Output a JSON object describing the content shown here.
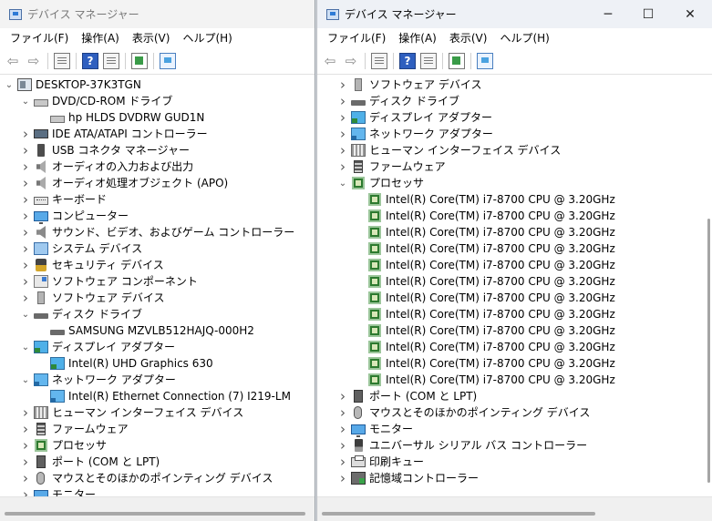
{
  "title": "デバイス マネージャー",
  "menu": [
    "ファイル(F)",
    "操作(A)",
    "表示(V)",
    "ヘルプ(H)"
  ],
  "window_controls": {
    "minimize": "─",
    "maximize": "☐",
    "close": "✕"
  },
  "toolbar": {
    "back": "⇦",
    "forward": "⇨",
    "help": "?"
  },
  "left_tree": [
    {
      "indent": 0,
      "toggle": "v",
      "icon": "computer-icon",
      "label": "DESKTOP-37K3TGN"
    },
    {
      "indent": 1,
      "toggle": "v",
      "icon": "dvd-drive-icon",
      "label": "DVD/CD-ROM ドライブ"
    },
    {
      "indent": 2,
      "toggle": "",
      "icon": "dvd-drive-icon",
      "label": "hp HLDS DVDRW  GUD1N"
    },
    {
      "indent": 1,
      "toggle": ">",
      "icon": "ide-controller-icon",
      "label": "IDE ATA/ATAPI コントローラー"
    },
    {
      "indent": 1,
      "toggle": ">",
      "icon": "usb-connector-icon",
      "label": "USB コネクタ マネージャー"
    },
    {
      "indent": 1,
      "toggle": ">",
      "icon": "audio-io-icon",
      "label": "オーディオの入力および出力"
    },
    {
      "indent": 1,
      "toggle": ">",
      "icon": "audio-apo-icon",
      "label": "オーディオ処理オブジェクト (APO)"
    },
    {
      "indent": 1,
      "toggle": ">",
      "icon": "keyboard-icon",
      "label": "キーボード"
    },
    {
      "indent": 1,
      "toggle": ">",
      "icon": "monitor-icon",
      "label": "コンピューター"
    },
    {
      "indent": 1,
      "toggle": ">",
      "icon": "sound-icon",
      "label": "サウンド、ビデオ、およびゲーム コントローラー"
    },
    {
      "indent": 1,
      "toggle": ">",
      "icon": "system-device-icon",
      "label": "システム デバイス"
    },
    {
      "indent": 1,
      "toggle": ">",
      "icon": "security-device-icon",
      "label": "セキュリティ デバイス"
    },
    {
      "indent": 1,
      "toggle": ">",
      "icon": "software-component-icon",
      "label": "ソフトウェア コンポーネント"
    },
    {
      "indent": 1,
      "toggle": ">",
      "icon": "software-device-icon",
      "label": "ソフトウェア デバイス"
    },
    {
      "indent": 1,
      "toggle": "v",
      "icon": "disk-drive-icon",
      "label": "ディスク ドライブ"
    },
    {
      "indent": 2,
      "toggle": "",
      "icon": "disk-drive-icon",
      "label": "SAMSUNG MZVLB512HAJQ-000H2"
    },
    {
      "indent": 1,
      "toggle": "v",
      "icon": "display-adapter-icon",
      "label": "ディスプレイ アダプター"
    },
    {
      "indent": 2,
      "toggle": "",
      "icon": "display-adapter-icon",
      "label": "Intel(R) UHD Graphics 630"
    },
    {
      "indent": 1,
      "toggle": "v",
      "icon": "network-adapter-icon",
      "label": "ネットワーク アダプター"
    },
    {
      "indent": 2,
      "toggle": "",
      "icon": "network-adapter-icon",
      "label": "Intel(R) Ethernet Connection (7) I219-LM"
    },
    {
      "indent": 1,
      "toggle": ">",
      "icon": "hid-icon",
      "label": "ヒューマン インターフェイス デバイス"
    },
    {
      "indent": 1,
      "toggle": ">",
      "icon": "firmware-icon",
      "label": "ファームウェア"
    },
    {
      "indent": 1,
      "toggle": ">",
      "icon": "processor-icon",
      "label": "プロセッサ"
    },
    {
      "indent": 1,
      "toggle": ">",
      "icon": "port-icon",
      "label": "ポート (COM と LPT)"
    },
    {
      "indent": 1,
      "toggle": ">",
      "icon": "mouse-icon",
      "label": "マウスとそのほかのポインティング デバイス"
    },
    {
      "indent": 1,
      "toggle": ">",
      "icon": "monitor-icon",
      "label": "モニター"
    }
  ],
  "right_tree": [
    {
      "indent": 1,
      "toggle": ">",
      "icon": "software-device-icon",
      "label": "ソフトウェア デバイス"
    },
    {
      "indent": 1,
      "toggle": ">",
      "icon": "disk-drive-icon",
      "label": "ディスク ドライブ"
    },
    {
      "indent": 1,
      "toggle": ">",
      "icon": "display-adapter-icon",
      "label": "ディスプレイ アダプター"
    },
    {
      "indent": 1,
      "toggle": ">",
      "icon": "network-adapter-icon",
      "label": "ネットワーク アダプター"
    },
    {
      "indent": 1,
      "toggle": ">",
      "icon": "hid-icon",
      "label": "ヒューマン インターフェイス デバイス"
    },
    {
      "indent": 1,
      "toggle": ">",
      "icon": "firmware-icon",
      "label": "ファームウェア"
    },
    {
      "indent": 1,
      "toggle": "v",
      "icon": "processor-icon",
      "label": "プロセッサ"
    },
    {
      "indent": 2,
      "toggle": "",
      "icon": "processor-icon",
      "label": "Intel(R) Core(TM) i7-8700 CPU @ 3.20GHz"
    },
    {
      "indent": 2,
      "toggle": "",
      "icon": "processor-icon",
      "label": "Intel(R) Core(TM) i7-8700 CPU @ 3.20GHz"
    },
    {
      "indent": 2,
      "toggle": "",
      "icon": "processor-icon",
      "label": "Intel(R) Core(TM) i7-8700 CPU @ 3.20GHz"
    },
    {
      "indent": 2,
      "toggle": "",
      "icon": "processor-icon",
      "label": "Intel(R) Core(TM) i7-8700 CPU @ 3.20GHz"
    },
    {
      "indent": 2,
      "toggle": "",
      "icon": "processor-icon",
      "label": "Intel(R) Core(TM) i7-8700 CPU @ 3.20GHz"
    },
    {
      "indent": 2,
      "toggle": "",
      "icon": "processor-icon",
      "label": "Intel(R) Core(TM) i7-8700 CPU @ 3.20GHz"
    },
    {
      "indent": 2,
      "toggle": "",
      "icon": "processor-icon",
      "label": "Intel(R) Core(TM) i7-8700 CPU @ 3.20GHz"
    },
    {
      "indent": 2,
      "toggle": "",
      "icon": "processor-icon",
      "label": "Intel(R) Core(TM) i7-8700 CPU @ 3.20GHz"
    },
    {
      "indent": 2,
      "toggle": "",
      "icon": "processor-icon",
      "label": "Intel(R) Core(TM) i7-8700 CPU @ 3.20GHz"
    },
    {
      "indent": 2,
      "toggle": "",
      "icon": "processor-icon",
      "label": "Intel(R) Core(TM) i7-8700 CPU @ 3.20GHz"
    },
    {
      "indent": 2,
      "toggle": "",
      "icon": "processor-icon",
      "label": "Intel(R) Core(TM) i7-8700 CPU @ 3.20GHz"
    },
    {
      "indent": 2,
      "toggle": "",
      "icon": "processor-icon",
      "label": "Intel(R) Core(TM) i7-8700 CPU @ 3.20GHz"
    },
    {
      "indent": 1,
      "toggle": ">",
      "icon": "port-icon",
      "label": "ポート (COM と LPT)"
    },
    {
      "indent": 1,
      "toggle": ">",
      "icon": "mouse-icon",
      "label": "マウスとそのほかのポインティング デバイス"
    },
    {
      "indent": 1,
      "toggle": ">",
      "icon": "monitor-icon",
      "label": "モニター"
    },
    {
      "indent": 1,
      "toggle": ">",
      "icon": "usb-controller-icon",
      "label": "ユニバーサル シリアル バス コントローラー"
    },
    {
      "indent": 1,
      "toggle": ">",
      "icon": "print-queue-icon",
      "label": "印刷キュー"
    },
    {
      "indent": 1,
      "toggle": ">",
      "icon": "storage-controller-icon",
      "label": "記憶域コントローラー"
    }
  ]
}
